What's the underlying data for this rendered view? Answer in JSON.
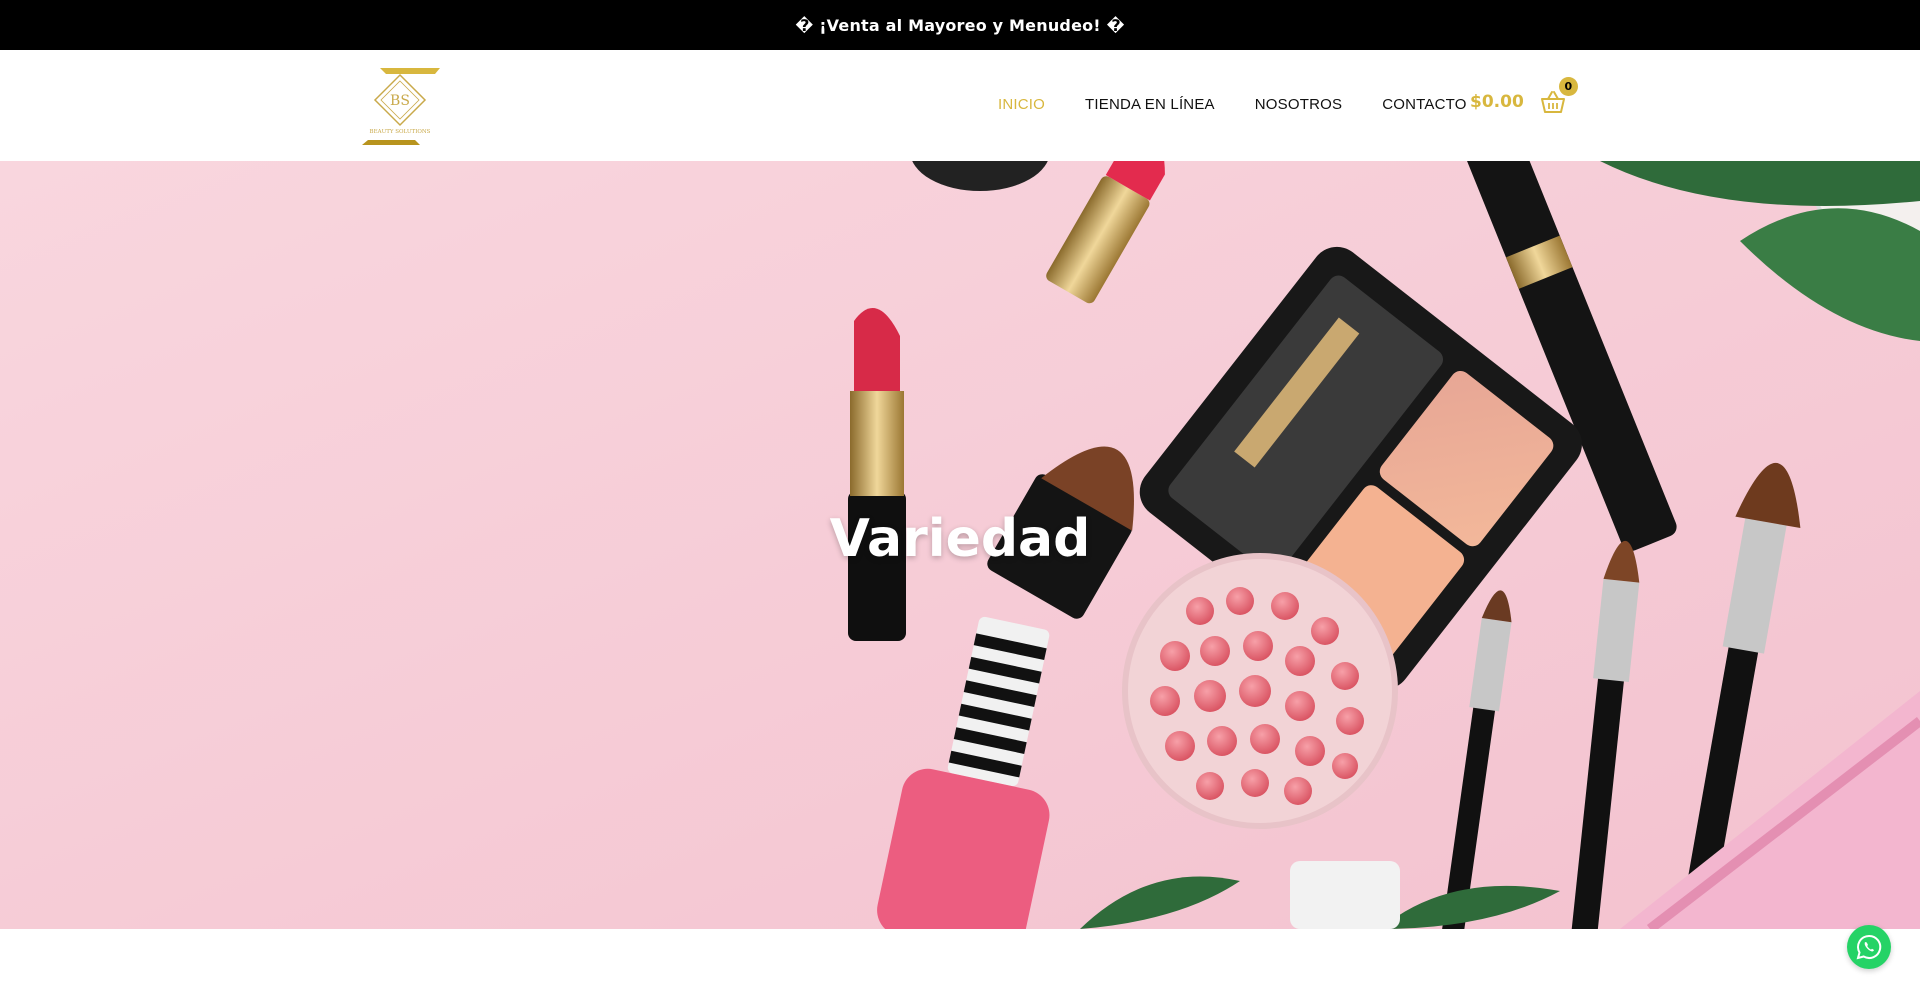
{
  "announcement": {
    "text": "� ¡Venta al Mayoreo y Menudeo! �"
  },
  "brand": {
    "logo_letters": "BS",
    "logo_caption": "BEAUTY SOLUTIONS",
    "accent_color": "#d8b73e"
  },
  "nav": {
    "items": [
      {
        "label": "INICIO",
        "active": true
      },
      {
        "label": "TIENDA EN LÍNEA",
        "active": false
      },
      {
        "label": "NOSOTROS",
        "active": false
      },
      {
        "label": "CONTACTO",
        "active": false
      }
    ]
  },
  "cart": {
    "total": "$0.00",
    "count": "0",
    "icon": "basket-icon"
  },
  "hero": {
    "title": "Variedad",
    "background_color": "#f6cdd8"
  },
  "floating": {
    "whatsapp_icon": "whatsapp-icon",
    "color": "#25d366"
  }
}
